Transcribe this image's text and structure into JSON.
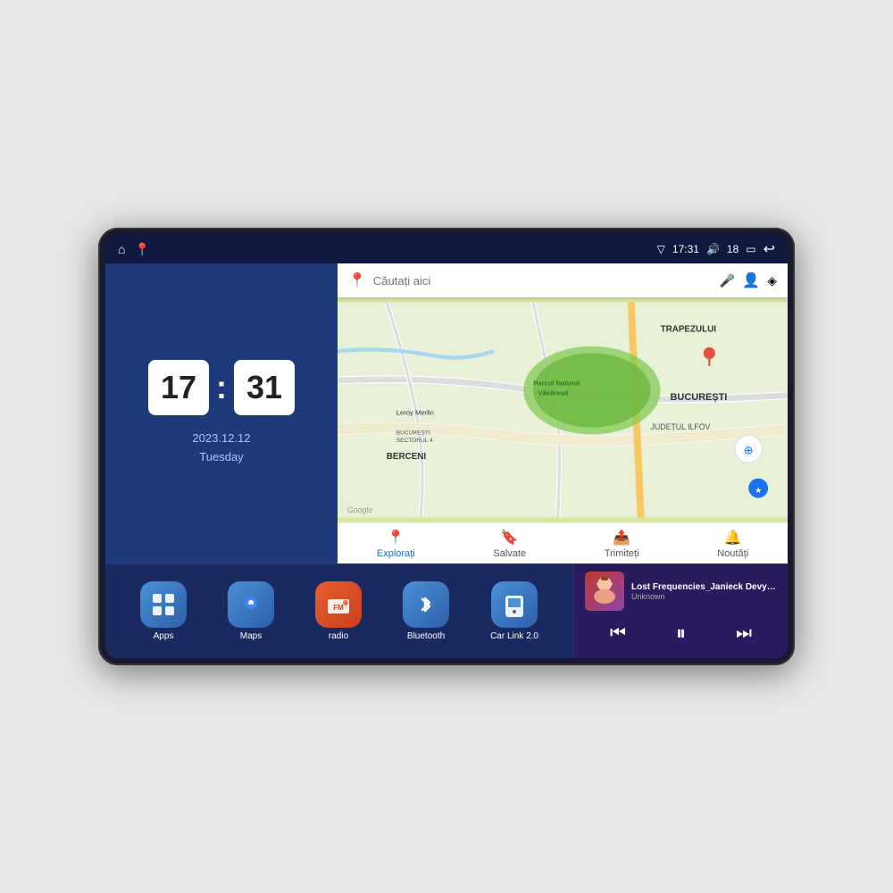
{
  "device": {
    "status_bar": {
      "left_icons": [
        "home",
        "maps"
      ],
      "time": "17:31",
      "volume_icon": "🔊",
      "battery_level": "18",
      "battery_icon": "🔋",
      "back_icon": "↩"
    },
    "clock": {
      "hours": "17",
      "minutes": "31",
      "date": "2023.12.12",
      "day": "Tuesday"
    },
    "map": {
      "search_placeholder": "Căutați aici",
      "location_labels": [
        "TRAPEZULUI",
        "BUCUREȘTI",
        "JUDEȚUL ILFOV",
        "BERCENI",
        "Parcul Natural Văcărești",
        "Leroy Merlin",
        "BUCUREȘTI SECTORUL 4"
      ],
      "tabs": [
        {
          "label": "Explorați",
          "icon": "📍",
          "active": true
        },
        {
          "label": "Salvate",
          "icon": "🔖",
          "active": false
        },
        {
          "label": "Trimiteți",
          "icon": "📤",
          "active": false
        },
        {
          "label": "Noutăți",
          "icon": "🔔",
          "active": false
        }
      ]
    },
    "apps": [
      {
        "id": "apps",
        "label": "Apps",
        "icon_class": "icon-apps",
        "icon": "⊞"
      },
      {
        "id": "maps",
        "label": "Maps",
        "icon_class": "icon-maps",
        "icon": "📍"
      },
      {
        "id": "radio",
        "label": "radio",
        "icon_class": "icon-radio",
        "icon": "📻"
      },
      {
        "id": "bluetooth",
        "label": "Bluetooth",
        "icon_class": "icon-bluetooth",
        "icon": "₿"
      },
      {
        "id": "carlink",
        "label": "Car Link 2.0",
        "icon_class": "icon-carlink",
        "icon": "📱"
      }
    ],
    "music": {
      "title": "Lost Frequencies_Janieck Devy-...",
      "artist": "Unknown",
      "controls": {
        "prev": "⏮",
        "play": "⏸",
        "next": "⏭"
      }
    }
  }
}
